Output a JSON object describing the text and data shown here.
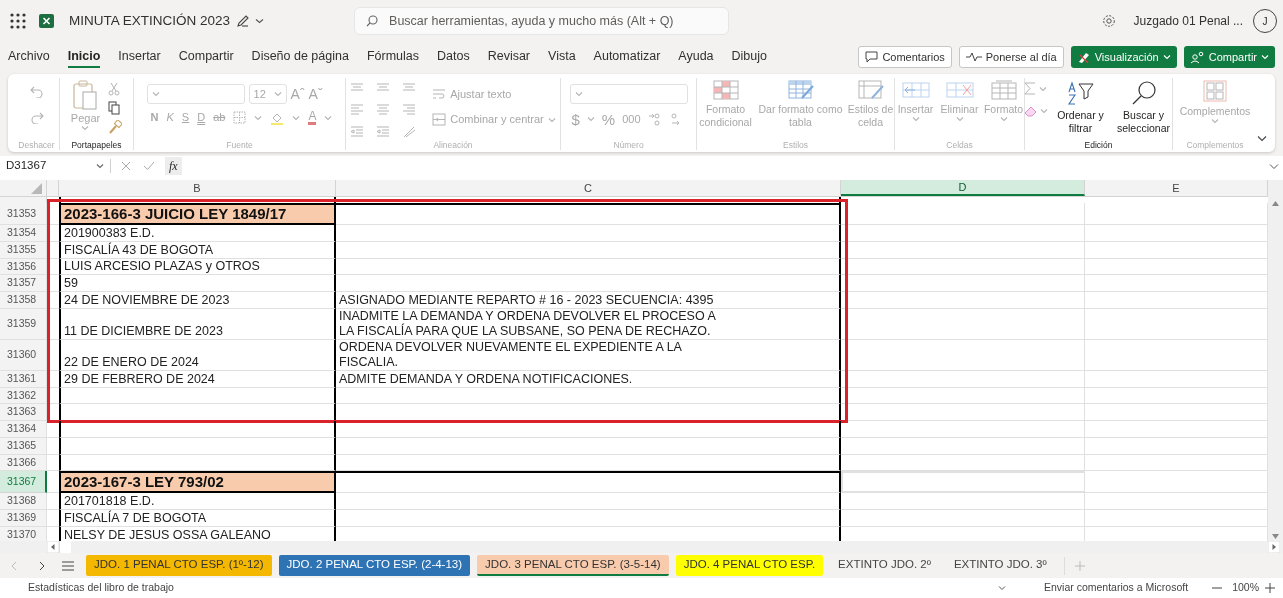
{
  "window": {
    "title": "MINUTA EXTINCIÓN 2023",
    "search_placeholder": "Buscar herramientas, ayuda y mucho más (Alt + Q)",
    "user": "Juzgado 01 Penal ...",
    "avatar": "J"
  },
  "menu": [
    {
      "label": "Archivo",
      "selected": false
    },
    {
      "label": "Inicio",
      "selected": true
    },
    {
      "label": "Insertar",
      "selected": false
    },
    {
      "label": "Compartir",
      "selected": false
    },
    {
      "label": "Diseño de página",
      "selected": false
    },
    {
      "label": "Fórmulas",
      "selected": false
    },
    {
      "label": "Datos",
      "selected": false
    },
    {
      "label": "Revisar",
      "selected": false
    },
    {
      "label": "Vista",
      "selected": false
    },
    {
      "label": "Automatizar",
      "selected": false
    },
    {
      "label": "Ayuda",
      "selected": false
    },
    {
      "label": "Dibujo",
      "selected": false
    }
  ],
  "actions": [
    {
      "label": "Comentarios",
      "kind": "outline"
    },
    {
      "label": "Ponerse al día",
      "kind": "outline"
    },
    {
      "label": "Visualización",
      "kind": "primary"
    },
    {
      "label": "Compartir",
      "kind": "primary"
    }
  ],
  "ribbon": {
    "groups": [
      {
        "label": "Deshacer",
        "disabled": true
      },
      {
        "label": "Portapapeles",
        "disabled": false,
        "items": [
          {
            "label": "Pegar",
            "disabled": true
          }
        ]
      },
      {
        "label": "Fuente",
        "disabled": true,
        "items": [
          {
            "label": "12",
            "disabled": true
          },
          {
            "label": "Aˆ",
            "disabled": true
          },
          {
            "label": "Aˇ",
            "disabled": true
          },
          {
            "label": "N",
            "disabled": true
          },
          {
            "label": "K",
            "disabled": true
          },
          {
            "label": "S",
            "disabled": true
          },
          {
            "label": "D",
            "disabled": true
          },
          {
            "label": "ab",
            "disabled": true
          },
          {
            "label": "A",
            "disabled": true
          }
        ]
      },
      {
        "label": "Alineación",
        "disabled": true,
        "items": [
          {
            "label": "Ajustar texto",
            "disabled": true
          },
          {
            "label": "Combinar y centrar",
            "disabled": true
          }
        ]
      },
      {
        "label": "Número",
        "disabled": true,
        "items": [
          {
            "label": "$",
            "disabled": true
          },
          {
            "label": "%",
            "disabled": true
          },
          {
            "label": "000",
            "disabled": true
          }
        ]
      },
      {
        "label": "Estilos",
        "disabled": true,
        "items": [
          {
            "label": "Formato condicional",
            "disabled": true
          },
          {
            "label": "Dar formato como tabla",
            "disabled": true
          },
          {
            "label": "Estilos de celda",
            "disabled": true
          }
        ]
      },
      {
        "label": "Celdas",
        "disabled": true,
        "items": [
          {
            "label": "Insertar",
            "disabled": true
          },
          {
            "label": "Eliminar",
            "disabled": true
          },
          {
            "label": "Formato",
            "disabled": true
          }
        ]
      },
      {
        "label": "Edición",
        "disabled": false,
        "items": [
          {
            "label": "Ordenar y filtrar",
            "disabled": false
          },
          {
            "label": "Buscar y seleccionar",
            "disabled": false
          }
        ]
      },
      {
        "label": "Complementos",
        "disabled": true,
        "items": [
          {
            "label": "Complementos",
            "disabled": true
          }
        ]
      }
    ]
  },
  "formula_bar": {
    "name_box": "D31367",
    "function_label": "fx"
  },
  "columns": [
    {
      "label": "B",
      "selected": false
    },
    {
      "label": "C",
      "selected": false
    },
    {
      "label": "D",
      "selected": true
    },
    {
      "label": "E",
      "selected": false
    }
  ],
  "rows": [
    {
      "number": "31353",
      "kind": "title",
      "b": "2023-166-3 JUICIO LEY 1849/17",
      "c": "",
      "selected": false,
      "highlighted": true
    },
    {
      "number": "31354",
      "kind": "data",
      "b": "201900383 E.D.",
      "c": "",
      "selected": false,
      "highlighted": true
    },
    {
      "number": "31355",
      "kind": "data",
      "b": "FISCALÍA 43 DE BOGOTA",
      "c": "",
      "selected": false,
      "highlighted": true
    },
    {
      "number": "31356",
      "kind": "data",
      "b": "LUIS ARCESIO PLAZAS y OTROS",
      "c": "",
      "selected": false,
      "highlighted": true
    },
    {
      "number": "31357",
      "kind": "data",
      "b": "59",
      "c": "",
      "selected": false,
      "highlighted": true
    },
    {
      "number": "31358",
      "kind": "data",
      "b": "24 DE NOVIEMBRE DE 2023",
      "c": "ASIGNADO MEDIANTE REPARTO # 16 - 2023 SECUENCIA: 4395",
      "selected": false,
      "highlighted": true
    },
    {
      "number": "31359",
      "kind": "data",
      "b": "11 DE DICIEMBRE DE 2023",
      "c": "INADMITE LA DEMANDA Y ORDENA DEVOLVER EL PROCESO A\nLA FISCALÍA PARA QUE LA SUBSANE, SO PENA DE RECHAZO.",
      "selected": false,
      "highlighted": true
    },
    {
      "number": "31360",
      "kind": "data",
      "b": "22 DE ENERO DE 2024",
      "c": "ORDENA DEVOLVER NUEVAMENTE EL EXPEDIENTE A LA\nFISCALIA.",
      "selected": false,
      "highlighted": true
    },
    {
      "number": "31361",
      "kind": "data",
      "b": "29 DE FEBRERO DE 2024",
      "c": "ADMITE DEMANDA Y ORDENA NOTIFICACIONES.",
      "selected": false,
      "highlighted": true
    },
    {
      "number": "31362",
      "kind": "data",
      "b": "",
      "c": "",
      "selected": false,
      "highlighted": true
    },
    {
      "number": "31363",
      "kind": "data",
      "b": "",
      "c": "",
      "selected": false,
      "highlighted": true
    },
    {
      "number": "31364",
      "kind": "data",
      "b": "",
      "c": "",
      "selected": false,
      "highlighted": false
    },
    {
      "number": "31365",
      "kind": "data",
      "b": "",
      "c": "",
      "selected": false,
      "highlighted": false
    },
    {
      "number": "31366",
      "kind": "data",
      "b": "",
      "c": "",
      "selected": false,
      "highlighted": false
    },
    {
      "number": "31367",
      "kind": "title",
      "b": "2023-167-3 LEY 793/02",
      "c": "",
      "selected": true,
      "highlighted": false
    },
    {
      "number": "31368",
      "kind": "data",
      "b": "201701818 E.D.",
      "c": "",
      "selected": false,
      "highlighted": false
    },
    {
      "number": "31369",
      "kind": "data",
      "b": "FISCALÍA 7 DE BOGOTA",
      "c": "",
      "selected": false,
      "highlighted": false
    },
    {
      "number": "31370",
      "kind": "data",
      "b": "NELSY DE JESUS OSSA GALEANO",
      "c": "",
      "selected": false,
      "highlighted": false
    }
  ],
  "sheets": [
    {
      "label": "JDO. 1 PENAL CTO ESP. (1º-12)",
      "color": "#f5b800",
      "selected": false
    },
    {
      "label": "JDO. 2 PENAL CTO ESP. (2-4-13)",
      "color": "#2e74b5",
      "selected": false
    },
    {
      "label": "JDO. 3 PENAL CTO ESP. (3-5-14)",
      "color": "#f8cbad",
      "selected": true
    },
    {
      "label": "JDO. 4 PENAL CTO ESP.",
      "color": "#ffff00",
      "selected": false
    },
    {
      "label": "EXTINTO JDO. 2º",
      "selected": false
    },
    {
      "label": "EXTINTO JDO. 3º",
      "selected": false
    }
  ],
  "status_bar": {
    "left": "Estadísticas del libro de trabajo",
    "feedback": "Enviar comentarios a Microsoft",
    "zoom": "100%"
  }
}
